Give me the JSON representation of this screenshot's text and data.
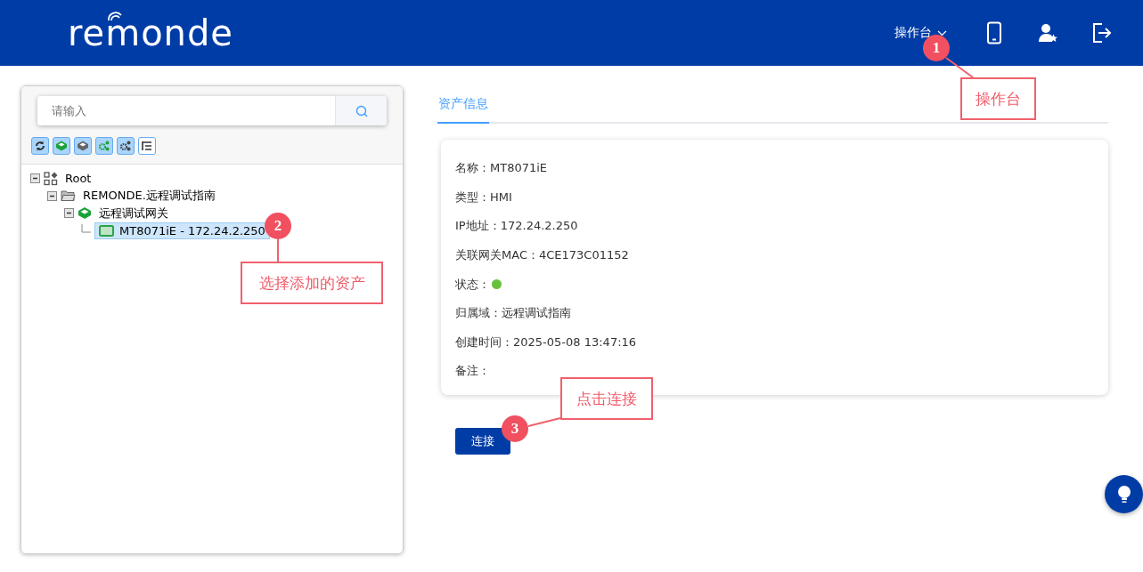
{
  "header": {
    "logo": "remonde",
    "menu": "操作台"
  },
  "search": {
    "placeholder": "请输入"
  },
  "tree": [
    {
      "label": "Root",
      "kind": "root",
      "expanded": true,
      "selected": false,
      "children": [
        {
          "label": "REMONDE.远程调试指南",
          "kind": "folder",
          "expanded": true,
          "selected": false,
          "children": [
            {
              "label": "远程调试网关",
              "kind": "gateway",
              "expanded": true,
              "selected": false,
              "children": [
                {
                  "label": "MT8071iE - 172.24.2.250",
                  "kind": "device",
                  "selected": true
                }
              ]
            }
          ]
        }
      ]
    }
  ],
  "tabs": [
    {
      "label": "资产信息",
      "selected": true
    }
  ],
  "fields": [
    {
      "label": "名称：",
      "value": "MT8071iE"
    },
    {
      "label": "类型：",
      "value": "HMI"
    },
    {
      "label": "IP地址：",
      "value": "172.24.2.250"
    },
    {
      "label": "关联网关MAC：",
      "value": "4CE173C01152"
    },
    {
      "label": "状态：",
      "kind": "status",
      "color": "#67c23a"
    },
    {
      "label": "归属域：",
      "value": "远程调试指南"
    },
    {
      "label": "创建时间：",
      "value": "2025-05-08 13:47:16"
    },
    {
      "label": "备注："
    }
  ],
  "connect_button": "连接",
  "callouts": [
    {
      "number": "1",
      "text": "操作台"
    },
    {
      "number": "2",
      "text": "选择添加的资产"
    },
    {
      "number": "3",
      "text": "点击连接"
    }
  ]
}
